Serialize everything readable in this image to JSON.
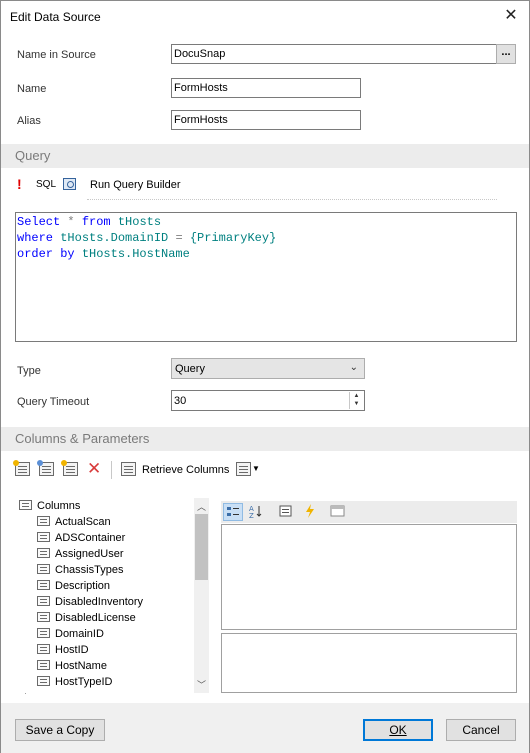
{
  "window": {
    "title": "Edit Data Source",
    "close_glyph": "✕"
  },
  "general": {
    "name_in_source_label": "Name in Source",
    "name_in_source_value": "DocuSnap",
    "browse_label": "...",
    "name_label": "Name",
    "name_value": "FormHosts",
    "alias_label": "Alias",
    "alias_value": "FormHosts"
  },
  "query_section": {
    "header": "Query",
    "toolbar": {
      "exclamation": "!",
      "sql_label": "SQL",
      "run_builder_label": "Run Query Builder"
    },
    "code": {
      "line1": {
        "kw1": "Select",
        "sym1": "*",
        "kw2": "from",
        "id1": "tHosts"
      },
      "line2": {
        "kw1": "where",
        "id1": "tHosts.DomainID",
        "sym1": "=",
        "id2": "{PrimaryKey}"
      },
      "line3": {
        "kw1": "order by",
        "id1": "tHosts.HostName"
      }
    },
    "type_label": "Type",
    "type_value": "Query",
    "timeout_label": "Query Timeout",
    "timeout_value": "30"
  },
  "columns_section": {
    "header": "Columns & Parameters",
    "retrieve_label": "Retrieve Columns",
    "tree_root": "Columns",
    "columns": [
      "ActualScan",
      "ADSContainer",
      "AssignedUser",
      "ChassisTypes",
      "Description",
      "DisabledInventory",
      "DisabledLicense",
      "DomainID",
      "HostID",
      "HostName",
      "HostTypeID"
    ]
  },
  "footer": {
    "save_copy": "Save a Copy",
    "ok": "OK",
    "cancel": "Cancel"
  },
  "icons": [
    "alert-icon",
    "sql-icon",
    "query-builder-icon",
    "add-column-icon",
    "add-parameter-icon",
    "add-calculated-icon",
    "delete-icon",
    "retrieve-columns-icon",
    "grid-options-icon",
    "categorized-icon",
    "alphabetical-icon",
    "properties-icon",
    "events-icon",
    "property-pages-icon"
  ]
}
